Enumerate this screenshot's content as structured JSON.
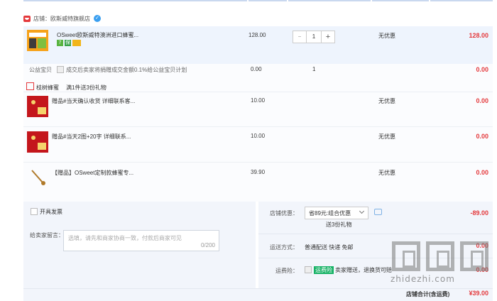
{
  "shop": {
    "label": "店铺：欧斯威特旗舰店",
    "wang_icon": "wangwang-chat-icon"
  },
  "items": [
    {
      "name": "OSweet欧斯威特澳洲进口蜂蜜...",
      "badges": [
        "7",
        "保"
      ],
      "price": "128.00",
      "quantity": "1",
      "discount": "无优惠",
      "total": "128.00"
    },
    {
      "name": "赠品#当天确认收货 详细联系客...",
      "price": "10.00",
      "discount": "无优惠",
      "total": "0.00"
    },
    {
      "name": "赠品#当天2图+20字 详细联系...",
      "price": "10.00",
      "discount": "无优惠",
      "total": "0.00"
    },
    {
      "name": "【赠品】OSweet定制款蜂蜜专...",
      "price": "39.90",
      "discount": "无优惠",
      "total": "0.00"
    }
  ],
  "charity": {
    "label": "公益宝贝",
    "text": "成交后卖家将捐赠成交金额0.1%给公益宝贝计划",
    "price": "0.00",
    "quantity": "1",
    "total": "0.00"
  },
  "gift_promo": {
    "title": "枝树蜂蜜",
    "desc": "满1件送3份礼物"
  },
  "invoice": {
    "label": "开具发票"
  },
  "message": {
    "label": "给卖家留言：",
    "placeholder": "选填，请先和商家协商一致，付款后商家可见",
    "counter": "0/200"
  },
  "shop_discount": {
    "label": "店铺优惠：",
    "selected": "省89元:组合优惠",
    "sub": "送3份礼物",
    "amount": "-89.00"
  },
  "delivery": {
    "label": "运送方式：",
    "value": "普通配送 快递 免邮",
    "amount": "0.00"
  },
  "insurance": {
    "label": "运费险：",
    "tag": "运费险",
    "text": "卖家赠送，退换货可赔",
    "amount": "0.00"
  },
  "footer": {
    "label": "店铺合计(含运费)",
    "amount": "¥39.00"
  },
  "watermark": {
    "text": "zhidezhi.com"
  },
  "colors": {
    "accent_red": "#e4393c",
    "panel_blue": "#eef4fd",
    "panel_grey": "#f2f5fb",
    "green": "#16b265"
  }
}
